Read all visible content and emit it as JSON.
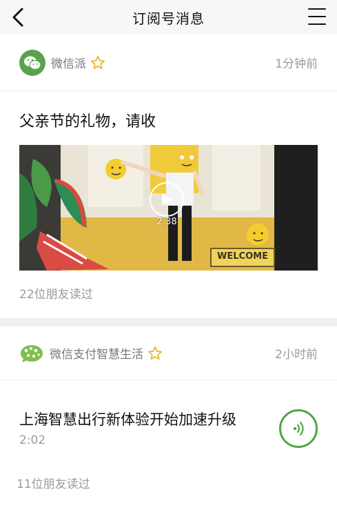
{
  "navbar": {
    "title": "订阅号消息",
    "back_icon": "chevron-left-icon",
    "menu_icon": "hamburger-menu-icon"
  },
  "messages": [
    {
      "account_name": "微信派",
      "time": "1分钟前",
      "article_title": "父亲节的礼物，请收",
      "video_duration": "2:38",
      "video_sign_text": "WELCOME",
      "read_count": "22位朋友读过"
    },
    {
      "account_name": "微信支付智慧生活",
      "time": "2小时前",
      "audio_title": "上海智慧出行新体验开始加速升级",
      "audio_duration": "2:02",
      "read_count": "11位朋友读过"
    }
  ],
  "colors": {
    "accent_green": "#4ca646",
    "star_gold": "#e6b422",
    "background": "#efeff4"
  }
}
